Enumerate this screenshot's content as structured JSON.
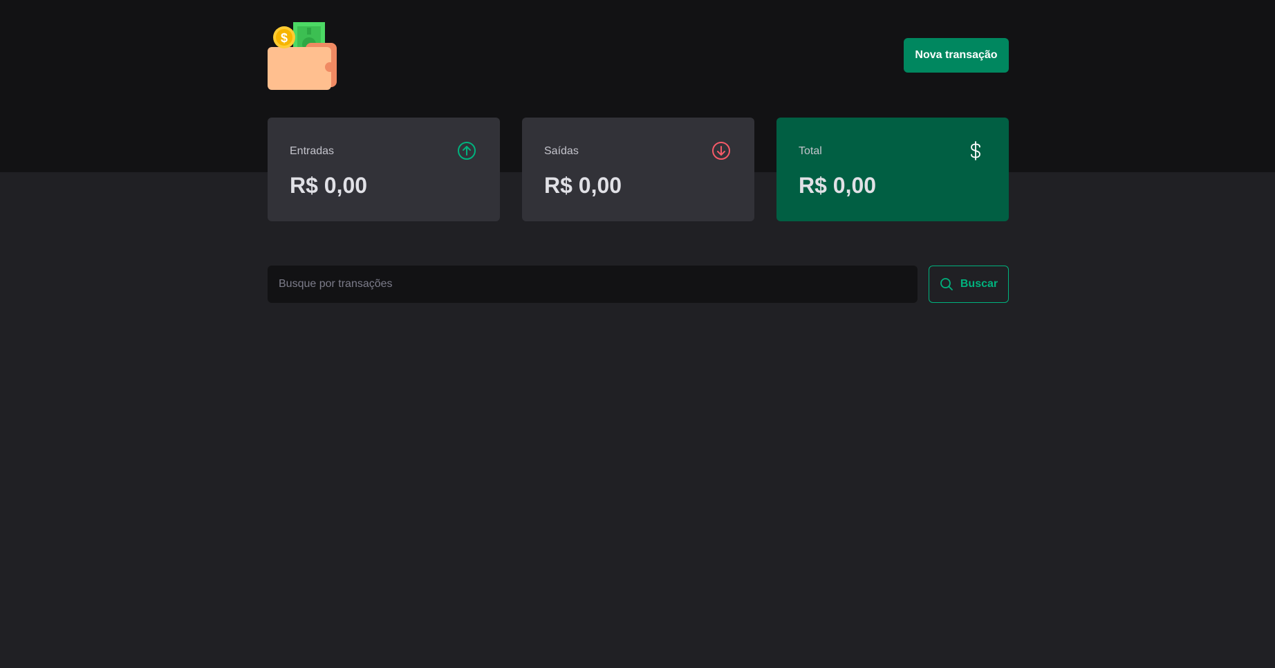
{
  "header": {
    "logo_icon": "wallet-money-icon",
    "new_transaction_label": "Nova transação"
  },
  "summary": {
    "income": {
      "label": "Entradas",
      "value": "R$ 0,00",
      "icon": "arrow-circle-up-icon",
      "icon_color": "#00b37e"
    },
    "outcome": {
      "label": "Saídas",
      "value": "R$ 0,00",
      "icon": "arrow-circle-down-icon",
      "icon_color": "#f75a68"
    },
    "total": {
      "label": "Total",
      "value": "R$ 0,00",
      "icon": "currency-dollar-icon",
      "icon_color": "#ffffff"
    }
  },
  "search": {
    "placeholder": "Busque por transações",
    "value": "",
    "button_label": "Buscar"
  },
  "colors": {
    "header_background": "#121214",
    "page_background": "#202024",
    "card_background": "#323238",
    "total_card_background": "#015f43",
    "primary_button": "#00875f",
    "accent_green": "#00b37e",
    "accent_red": "#f75a68"
  }
}
